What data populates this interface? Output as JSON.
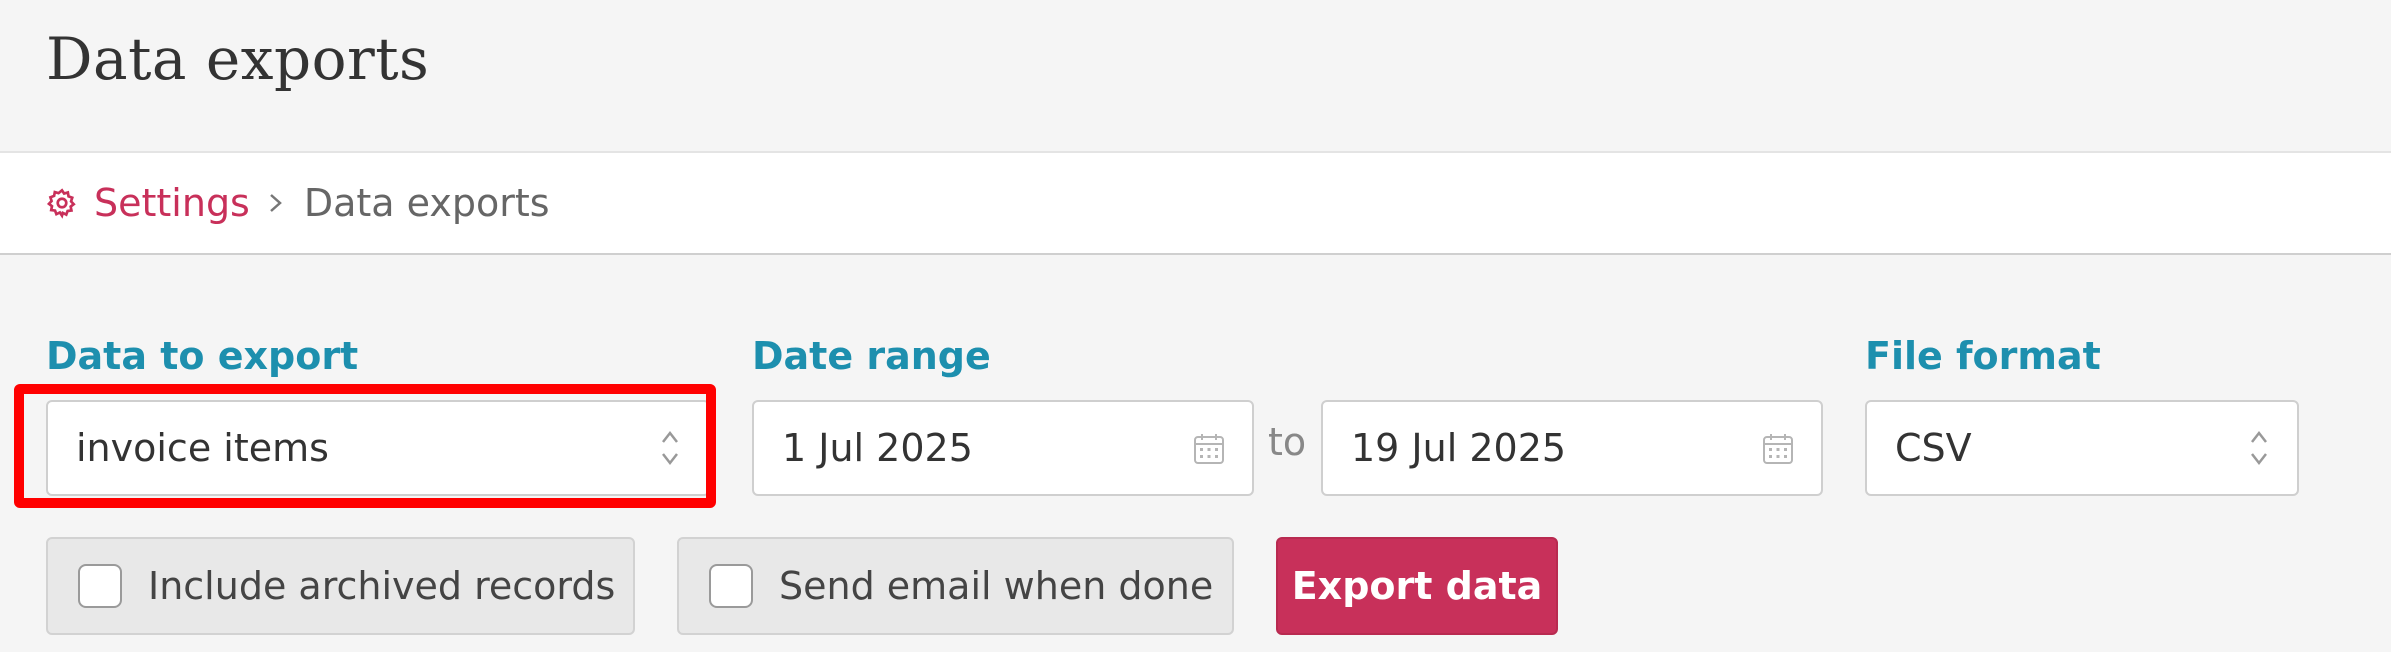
{
  "page": {
    "title": "Data exports"
  },
  "breadcrumb": {
    "parent_label": "Settings",
    "current_label": "Data exports",
    "icon": "gear-icon"
  },
  "form": {
    "data_to_export": {
      "label": "Data to export",
      "value": "invoice items"
    },
    "date_range": {
      "label": "Date range",
      "start": "1 Jul 2025",
      "separator": "to",
      "end": "19 Jul 2025"
    },
    "file_format": {
      "label": "File format",
      "value": "CSV"
    },
    "include_archived": {
      "label": "Include archived records",
      "checked": false
    },
    "send_email": {
      "label": "Send email when done",
      "checked": false
    },
    "export_button": {
      "label": "Export data"
    }
  },
  "colors": {
    "accent": "#c8305a",
    "label": "#1d8fae",
    "highlight": "#ff0000"
  }
}
